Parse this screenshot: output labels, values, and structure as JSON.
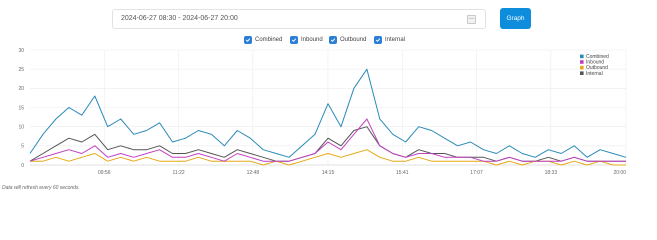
{
  "toolbar": {
    "date_range": "2024-06-27 08:30 - 2024-06-27 20:00",
    "graph_label": "Graph",
    "calendar_icon": "calendar-icon"
  },
  "filters": [
    {
      "label": "Combined",
      "checked": true
    },
    {
      "label": "Inbound",
      "checked": true
    },
    {
      "label": "Outbound",
      "checked": true
    },
    {
      "label": "Internal",
      "checked": true
    }
  ],
  "footnote": "Data will refresh every 60 seconds.",
  "chart_data": {
    "type": "line",
    "grid": true,
    "legend_position": "top-right",
    "ylim": [
      0,
      30
    ],
    "yticks": [
      0,
      5,
      10,
      15,
      20,
      25,
      30
    ],
    "xlim": [
      "08:30",
      "20:00"
    ],
    "xticks": [
      "09:56",
      "11:22",
      "12:48",
      "14:15",
      "15:41",
      "17:07",
      "18:33",
      "20:00"
    ],
    "series": [
      {
        "name": "Combined",
        "color": "#2a8ab8",
        "x": [
          "08:30",
          "08:45",
          "09:00",
          "09:15",
          "09:30",
          "09:45",
          "10:00",
          "10:15",
          "10:30",
          "10:45",
          "11:00",
          "11:15",
          "11:30",
          "11:45",
          "12:00",
          "12:15",
          "12:30",
          "12:45",
          "13:00",
          "13:15",
          "13:30",
          "13:45",
          "14:00",
          "14:15",
          "14:30",
          "14:45",
          "15:00",
          "15:15",
          "15:30",
          "15:45",
          "16:00",
          "16:15",
          "16:30",
          "16:45",
          "17:00",
          "17:15",
          "17:30",
          "17:45",
          "18:00",
          "18:15",
          "18:30",
          "18:45",
          "19:00",
          "19:15",
          "19:30",
          "19:45",
          "20:00"
        ],
        "values": [
          3,
          8,
          12,
          15,
          13,
          18,
          10,
          12,
          8,
          9,
          11,
          6,
          7,
          9,
          8,
          5,
          9,
          7,
          4,
          3,
          2,
          5,
          8,
          16,
          10,
          20,
          25,
          12,
          8,
          6,
          10,
          9,
          7,
          5,
          6,
          4,
          3,
          5,
          3,
          2,
          4,
          3,
          5,
          2,
          4,
          3,
          2
        ]
      },
      {
        "name": "Inbound",
        "color": "#c23fc4",
        "x": [
          "08:30",
          "08:45",
          "09:00",
          "09:15",
          "09:30",
          "09:45",
          "10:00",
          "10:15",
          "10:30",
          "10:45",
          "11:00",
          "11:15",
          "11:30",
          "11:45",
          "12:00",
          "12:15",
          "12:30",
          "12:45",
          "13:00",
          "13:15",
          "13:30",
          "13:45",
          "14:00",
          "14:15",
          "14:30",
          "14:45",
          "15:00",
          "15:15",
          "15:30",
          "15:45",
          "16:00",
          "16:15",
          "16:30",
          "16:45",
          "17:00",
          "17:15",
          "17:30",
          "17:45",
          "18:00",
          "18:15",
          "18:30",
          "18:45",
          "19:00",
          "19:15",
          "19:30",
          "19:45",
          "20:00"
        ],
        "values": [
          1,
          2,
          3,
          4,
          3,
          5,
          2,
          3,
          2,
          3,
          4,
          2,
          2,
          3,
          2,
          1,
          3,
          2,
          1,
          1,
          1,
          2,
          3,
          6,
          4,
          8,
          12,
          5,
          3,
          2,
          3,
          3,
          2,
          2,
          2,
          1,
          1,
          2,
          1,
          1,
          1,
          1,
          2,
          1,
          1,
          1,
          1
        ]
      },
      {
        "name": "Outbound",
        "color": "#e6a817",
        "x": [
          "08:30",
          "08:45",
          "09:00",
          "09:15",
          "09:30",
          "09:45",
          "10:00",
          "10:15",
          "10:30",
          "10:45",
          "11:00",
          "11:15",
          "11:30",
          "11:45",
          "12:00",
          "12:15",
          "12:30",
          "12:45",
          "13:00",
          "13:15",
          "13:30",
          "13:45",
          "14:00",
          "14:15",
          "14:30",
          "14:45",
          "15:00",
          "15:15",
          "15:30",
          "15:45",
          "16:00",
          "16:15",
          "16:30",
          "16:45",
          "17:00",
          "17:15",
          "17:30",
          "17:45",
          "18:00",
          "18:15",
          "18:30",
          "18:45",
          "19:00",
          "19:15",
          "19:30",
          "19:45",
          "20:00"
        ],
        "values": [
          1,
          1,
          2,
          1,
          2,
          3,
          1,
          2,
          1,
          2,
          1,
          1,
          1,
          2,
          1,
          1,
          1,
          1,
          0,
          1,
          0,
          1,
          2,
          3,
          2,
          3,
          4,
          2,
          1,
          1,
          2,
          1,
          1,
          1,
          1,
          1,
          0,
          1,
          0,
          1,
          1,
          0,
          1,
          0,
          1,
          0,
          0
        ]
      },
      {
        "name": "Internal",
        "color": "#555555",
        "x": [
          "08:30",
          "08:45",
          "09:00",
          "09:15",
          "09:30",
          "09:45",
          "10:00",
          "10:15",
          "10:30",
          "10:45",
          "11:00",
          "11:15",
          "11:30",
          "11:45",
          "12:00",
          "12:15",
          "12:30",
          "12:45",
          "13:00",
          "13:15",
          "13:30",
          "13:45",
          "14:00",
          "14:15",
          "14:30",
          "14:45",
          "15:00",
          "15:15",
          "15:30",
          "15:45",
          "16:00",
          "16:15",
          "16:30",
          "16:45",
          "17:00",
          "17:15",
          "17:30",
          "17:45",
          "18:00",
          "18:15",
          "18:30",
          "18:45",
          "19:00",
          "19:15",
          "19:30",
          "19:45",
          "20:00"
        ],
        "values": [
          1,
          3,
          5,
          7,
          6,
          8,
          4,
          5,
          4,
          4,
          5,
          3,
          3,
          4,
          3,
          2,
          4,
          3,
          2,
          1,
          1,
          2,
          3,
          7,
          5,
          9,
          10,
          5,
          3,
          2,
          4,
          3,
          3,
          2,
          2,
          2,
          1,
          2,
          1,
          1,
          2,
          1,
          2,
          1,
          1,
          1,
          1
        ]
      }
    ]
  }
}
